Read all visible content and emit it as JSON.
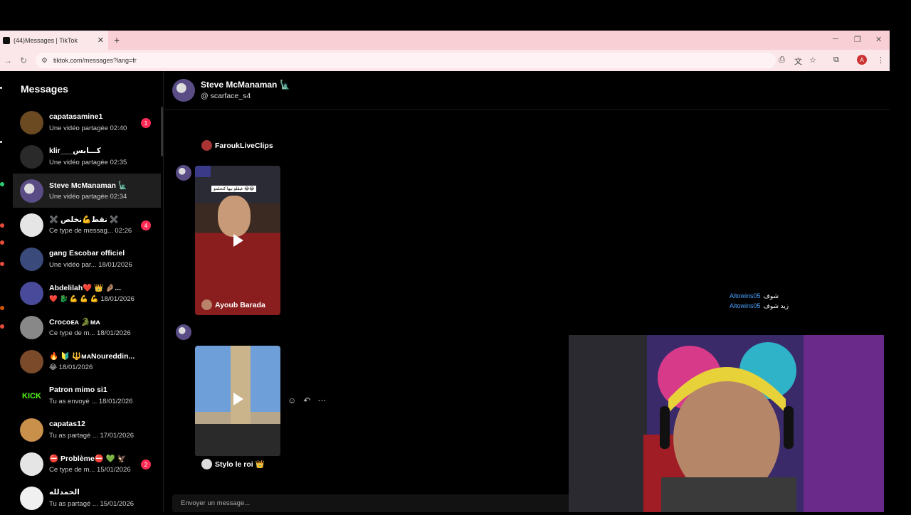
{
  "browser": {
    "tab_title": "(44)Messages | TikTok",
    "tab_close": "✕",
    "new_tab": "+",
    "url": "tiktok.com/messages?lang=fr",
    "profile_initial": "A"
  },
  "sidebar": {
    "title": "Messages",
    "conversations": [
      {
        "name": "capatasamine1",
        "preview": "Une vidéo partagée 02:40",
        "badge": "1",
        "color": "#6b4a22"
      },
      {
        "name": "klir___كـــابس",
        "preview": "Une vidéo partagée 02:35",
        "badge": "",
        "color": "#2a2a2a"
      },
      {
        "name": "Steve McManaman 🗽",
        "preview": "Une vidéo partagée 02:34",
        "badge": "",
        "color": "#5a4d86"
      },
      {
        "name": "✖️ نقط💪نخلص ✖️",
        "preview": "Ce type de messag... 02:26",
        "badge": "4",
        "color": "#e5e5e5"
      },
      {
        "name": "gang Escobar officiel",
        "preview": "Une vidéo par... 18/01/2026",
        "badge": "",
        "color": "#3a4a7a"
      },
      {
        "name": "Abdelilah❤️ 👑 🤌🏽...",
        "preview": "❤️ 🐉 💪 💪 💪 18/01/2026",
        "badge": "",
        "color": "#4a4a9a"
      },
      {
        "name": "Crocoᴇᴀ 🐊ᴍᴀ",
        "preview": "Ce type de m... 18/01/2026",
        "badge": "",
        "color": "#888888"
      },
      {
        "name": "🔥 🔰 🔱ᴍᴀNoureddin...",
        "preview": "😂 18/01/2026",
        "badge": "",
        "color": "#7a4a2a"
      },
      {
        "name": "Patron mimo si1",
        "preview": "Tu as envoyé ... 18/01/2026",
        "badge": "",
        "color": "#000000"
      },
      {
        "name": "capatas12",
        "preview": "Tu as partagé ... 17/01/2026",
        "badge": "",
        "color": "#c8904a"
      },
      {
        "name": "⛔ Problème⛔ 💚 🦅",
        "preview": "Ce type de m... 15/01/2026",
        "badge": "2",
        "color": "#e5e5e5"
      },
      {
        "name": "الحمدلله",
        "preview": "Tu as partagé ... 15/01/2026",
        "badge": "",
        "color": "#f0f0f0"
      }
    ],
    "kick_logo": "KICK"
  },
  "chat": {
    "name": "Steve McManaman 🗽",
    "handle": "@ scarface_s4",
    "shared_cards": [
      {
        "author": "FaroukLiveClips"
      },
      {
        "author": "Ayoub Barada",
        "caption": "غيقلو بيها كنحلمو 😂😂"
      },
      {
        "author": "Stylo le roi 👑"
      }
    ],
    "input_placeholder": "Envoyer un message..."
  },
  "stream_chat": [
    {
      "user": "Altowins05",
      "text": "شوف"
    },
    {
      "user": "Altowins05",
      "text": "زيد شوف"
    }
  ],
  "colors": {
    "accent_badge": "#fe2c55",
    "tab_bar": "#f9cfd6",
    "username": "#4aa3ff"
  }
}
